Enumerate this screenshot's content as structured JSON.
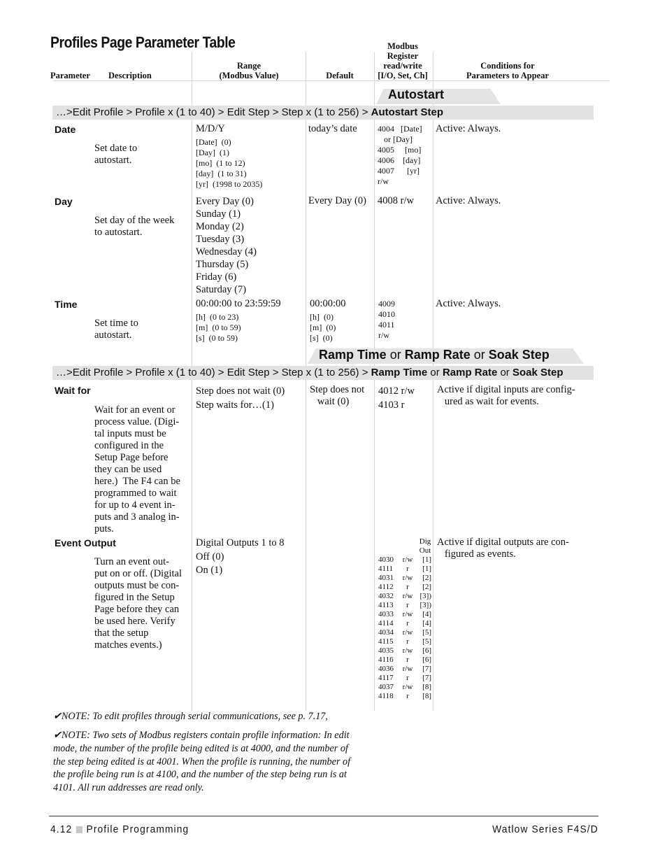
{
  "page_title": "Profiles Page Parameter Table",
  "columns": {
    "parameter": "Parameter",
    "description": "Description",
    "range": [
      "Range",
      "(Modbus Value)"
    ],
    "default": "Default",
    "modbus": [
      "Modbus",
      "Register",
      "read/write",
      "[I/O, Set, Ch]"
    ],
    "conditions": [
      "Conditions for",
      "Parameters to Appear"
    ]
  },
  "sections": [
    {
      "tab_parts": [
        {
          "text": "Autostart",
          "bold": true
        }
      ],
      "breadcrumb_prefix": "…>Edit Profile > Profile x (1 to 40) > Edit Step > Step x (1 to 256) > ",
      "breadcrumb_parts": [
        {
          "text": "Autostart Step",
          "bold": true
        }
      ],
      "rows": [
        {
          "parameter": "Date",
          "description": [
            "Set date to",
            "autostart."
          ],
          "range_main": [
            "M/D/Y"
          ],
          "range_sub": [
            "[Date]  (0)",
            "[Day]  (1)",
            "[mo]  (1 to 12)",
            "[day]  (1 to 31)",
            "[yr]  (1998 to 2035)"
          ],
          "default": [
            "today’s date"
          ],
          "default_sub": [],
          "modbus": [
            "4004   [Date]",
            "   or [Day]",
            "4005     [mo]",
            "4006    [day]",
            "4007      [yr]",
            "r/w"
          ],
          "conditions": [
            "Active: Always."
          ]
        },
        {
          "parameter": "Day",
          "description": [
            "Set day of the week",
            "to autostart."
          ],
          "range_main": [
            "Every Day (0)",
            "Sunday (1)",
            "Monday (2)",
            "Tuesday (3)",
            "Wednesday (4)",
            "Thursday (5)",
            "Friday (6)",
            "Saturday (7)"
          ],
          "range_sub": [],
          "default": [
            "Every Day (0)"
          ],
          "default_sub": [],
          "modbus": [
            "4008 r/w"
          ],
          "conditions": [
            "Active: Always."
          ]
        },
        {
          "parameter": "Time",
          "description": [
            "Set time to",
            "autostart."
          ],
          "range_main": [
            "00:00:00 to 23:59:59"
          ],
          "range_sub": [
            "[h]  (0 to 23)",
            "[m]  (0 to 59)",
            "[s]  (0 to 59)"
          ],
          "default": [
            "00:00:00"
          ],
          "default_sub": [
            "[h]  (0)",
            "[m]  (0)",
            "[s]  (0)"
          ],
          "modbus": [
            "4009",
            "4010",
            "4011",
            "r/w"
          ],
          "conditions": [
            "Active: Always."
          ]
        }
      ]
    },
    {
      "tab_parts": [
        {
          "text": "Ramp Time",
          "bold": true
        },
        {
          "text": " or ",
          "bold": false
        },
        {
          "text": "Ramp Rate",
          "bold": true
        },
        {
          "text": " or ",
          "bold": false
        },
        {
          "text": "Soak Step",
          "bold": true
        }
      ],
      "breadcrumb_prefix": "…>Edit Profile > Profile x (1 to 40) > Edit Step > Step x (1 to 256) > ",
      "breadcrumb_parts": [
        {
          "text": "Ramp Time",
          "bold": true
        },
        {
          "text": " or ",
          "bold": false
        },
        {
          "text": "Ramp Rate",
          "bold": true
        },
        {
          "text": " or ",
          "bold": false
        },
        {
          "text": "Soak Step",
          "bold": true
        }
      ],
      "rows": [
        {
          "parameter": "Wait for",
          "description": [
            "Wait for an event or",
            "process value. (Digi-",
            "tal inputs must be",
            "configured in the",
            "Setup Page before",
            "they can be used",
            "here.)  The F4 can be",
            "programmed to wait",
            "for up to 4 event in-",
            "puts and 3 analog in-",
            "puts."
          ],
          "range_main": [
            "Step does not wait (0)",
            "Step waits for…(1)"
          ],
          "range_sub": [],
          "default": [
            "Step does not",
            "   wait (0)"
          ],
          "default_sub": [],
          "modbus": [
            "4012 r/w",
            "4103 r"
          ],
          "conditions": [
            "Active if digital inputs are config-",
            "   ured as wait for events."
          ]
        },
        {
          "parameter": "Event Output",
          "description": [
            "Turn an event out-",
            "put on or off. (Digital",
            "outputs must be con-",
            "figured in the Setup",
            "Page before they can",
            "be used here. Verify",
            "that the setup",
            "matches events.)"
          ],
          "range_main": [
            "Digital Outputs 1 to 8",
            "Off (0)",
            "On (1)"
          ],
          "range_sub": [],
          "default": [],
          "default_sub": [],
          "modbus_header": [
            "Dig",
            "Out"
          ],
          "modbus_table": [
            [
              "4030",
              "r/w",
              "[1]"
            ],
            [
              "4111",
              "r",
              "[1]"
            ],
            [
              "4031",
              "r/w",
              "[2]"
            ],
            [
              "4112",
              "r",
              "[2]"
            ],
            [
              "4032",
              "r/w",
              "[3])"
            ],
            [
              "4113",
              "r",
              "[3])"
            ],
            [
              "4033",
              "r/w",
              "[4]"
            ],
            [
              "4114",
              "r",
              "[4]"
            ],
            [
              "4034",
              "r/w",
              "[5]"
            ],
            [
              "4115",
              "r",
              "[5]"
            ],
            [
              "4035",
              "r/w",
              "[6]"
            ],
            [
              "4116",
              "r",
              "[6]"
            ],
            [
              "4036",
              "r/w",
              "[7]"
            ],
            [
              "4117",
              "r",
              "[7]"
            ],
            [
              "4037",
              "r/w",
              "[8]"
            ],
            [
              "4118",
              "r",
              "[8]"
            ]
          ],
          "conditions": [
            "Active if digital outputs are con-",
            "   figured as events."
          ]
        }
      ]
    }
  ],
  "notes": [
    {
      "icon": "checkmark-icon",
      "glyph": "✔",
      "text": "NOTE: To edit profiles through serial communications, see p. 7.17,"
    },
    {
      "icon": "checkmark-icon",
      "glyph": "✔",
      "text": "NOTE: Two sets of Modbus registers contain profile information: In edit mode, the number of the profile being edited is at 4000, and the number of the step being edited is at 4001. When the profile is running, the number of the profile being run is at 4100, and the number of the step being run is at 4101. All run addresses are read only."
    }
  ],
  "footer": {
    "page_number": "4.12",
    "section": "Profile Programming",
    "product": "Watlow Series F4S/D"
  }
}
